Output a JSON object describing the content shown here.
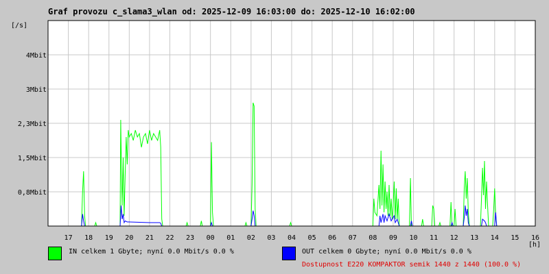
{
  "title": "Graf provozu c_slama3_wlan od: 2025-12-09 16:03:00 do: 2025-12-10 16:02:00",
  "colors": {
    "in": "#00ff00",
    "out": "#0000ff",
    "availability": "#e00000",
    "grid": "#c8c8c8"
  },
  "legend": {
    "in_text": "IN celkem 1 Gbyte; nyní   0.0 Mbit/s 0.0 %",
    "out_text": "OUT celkem 0 Gbyte; nyní   0.0 Mbit/s 0.0 %",
    "availability_text": "Dostupnost E220 KOMPAKTOR semik 1440 z 1440 (100.0 %)"
  },
  "chart_data": {
    "type": "line",
    "ylabel": "[/s]",
    "xlabel": "[h]",
    "xlim": [
      16.0,
      40.0
    ],
    "ylim": [
      0,
      6.0
    ],
    "y_ticks": [
      {
        "value": 1,
        "label": "0,8Mbit"
      },
      {
        "value": 2,
        "label": "1,5Mbit"
      },
      {
        "value": 3,
        "label": "2,3Mbit"
      },
      {
        "value": 4,
        "label": "3Mbit"
      },
      {
        "value": 5,
        "label": "4Mbit"
      },
      {
        "value": 6,
        "label": "[/s]"
      }
    ],
    "x_ticks": [
      {
        "value": 17,
        "label": "17"
      },
      {
        "value": 18,
        "label": "18"
      },
      {
        "value": 19,
        "label": "19"
      },
      {
        "value": 20,
        "label": "20"
      },
      {
        "value": 21,
        "label": "21"
      },
      {
        "value": 22,
        "label": "22"
      },
      {
        "value": 23,
        "label": "23"
      },
      {
        "value": 24,
        "label": "00"
      },
      {
        "value": 25,
        "label": "01"
      },
      {
        "value": 26,
        "label": "02"
      },
      {
        "value": 27,
        "label": "03"
      },
      {
        "value": 28,
        "label": "04"
      },
      {
        "value": 29,
        "label": "05"
      },
      {
        "value": 30,
        "label": "06"
      },
      {
        "value": 31,
        "label": "07"
      },
      {
        "value": 32,
        "label": "08"
      },
      {
        "value": 33,
        "label": "09"
      },
      {
        "value": 34,
        "label": "10"
      },
      {
        "value": 35,
        "label": "11"
      },
      {
        "value": 36,
        "label": "12"
      },
      {
        "value": 37,
        "label": "13"
      },
      {
        "value": 38,
        "label": "14"
      },
      {
        "value": 39,
        "label": "15"
      },
      {
        "value": 40,
        "label": "16"
      }
    ],
    "series": [
      {
        "name": "IN",
        "color": "#00ff00",
        "points": [
          [
            16.0,
            0
          ],
          [
            17.65,
            0
          ],
          [
            17.7,
            1.0
          ],
          [
            17.75,
            1.6
          ],
          [
            17.8,
            0.3
          ],
          [
            17.85,
            0
          ],
          [
            18.3,
            0
          ],
          [
            18.35,
            0.1
          ],
          [
            18.4,
            0
          ],
          [
            19.55,
            0
          ],
          [
            19.58,
            3.1
          ],
          [
            19.62,
            1.5
          ],
          [
            19.65,
            0.6
          ],
          [
            19.7,
            2.0
          ],
          [
            19.75,
            0.3
          ],
          [
            19.8,
            1.5
          ],
          [
            19.85,
            2.6
          ],
          [
            19.9,
            1.8
          ],
          [
            19.95,
            2.8
          ],
          [
            20.0,
            2.6
          ],
          [
            20.1,
            2.7
          ],
          [
            20.2,
            2.5
          ],
          [
            20.3,
            2.8
          ],
          [
            20.4,
            2.6
          ],
          [
            20.5,
            2.7
          ],
          [
            20.6,
            2.3
          ],
          [
            20.7,
            2.6
          ],
          [
            20.8,
            2.7
          ],
          [
            20.9,
            2.4
          ],
          [
            21.0,
            2.8
          ],
          [
            21.1,
            2.5
          ],
          [
            21.2,
            2.7
          ],
          [
            21.3,
            2.6
          ],
          [
            21.4,
            2.5
          ],
          [
            21.5,
            2.8
          ],
          [
            21.55,
            2.3
          ],
          [
            21.6,
            0.2
          ],
          [
            21.65,
            0
          ],
          [
            22.8,
            0
          ],
          [
            22.85,
            0.1
          ],
          [
            22.9,
            0
          ],
          [
            23.5,
            0
          ],
          [
            23.55,
            0.15
          ],
          [
            23.6,
            0
          ],
          [
            24.0,
            0
          ],
          [
            24.05,
            2.45
          ],
          [
            24.1,
            0.4
          ],
          [
            24.15,
            0
          ],
          [
            25.7,
            0
          ],
          [
            25.75,
            0.1
          ],
          [
            25.8,
            0
          ],
          [
            26.0,
            0
          ],
          [
            26.05,
            1.2
          ],
          [
            26.1,
            3.6
          ],
          [
            26.15,
            3.5
          ],
          [
            26.2,
            0.5
          ],
          [
            26.25,
            0
          ],
          [
            27.9,
            0
          ],
          [
            27.95,
            0.1
          ],
          [
            28.0,
            0
          ],
          [
            32.0,
            0
          ],
          [
            32.05,
            0.8
          ],
          [
            32.1,
            0.4
          ],
          [
            32.2,
            0.3
          ],
          [
            32.3,
            1.2
          ],
          [
            32.35,
            0.5
          ],
          [
            32.4,
            2.2
          ],
          [
            32.45,
            0.6
          ],
          [
            32.5,
            1.8
          ],
          [
            32.55,
            0.4
          ],
          [
            32.6,
            1.3
          ],
          [
            32.65,
            0.5
          ],
          [
            32.7,
            1.0
          ],
          [
            32.75,
            0.3
          ],
          [
            32.8,
            1.2
          ],
          [
            32.85,
            0.3
          ],
          [
            32.9,
            0.8
          ],
          [
            32.95,
            0.2
          ],
          [
            33.0,
            0.6
          ],
          [
            33.05,
            1.3
          ],
          [
            33.1,
            0.2
          ],
          [
            33.15,
            1.1
          ],
          [
            33.2,
            0.2
          ],
          [
            33.25,
            0.8
          ],
          [
            33.3,
            0
          ],
          [
            33.8,
            0
          ],
          [
            33.85,
            1.4
          ],
          [
            33.9,
            0
          ],
          [
            34.4,
            0
          ],
          [
            34.45,
            0.2
          ],
          [
            34.5,
            0
          ],
          [
            34.9,
            0
          ],
          [
            34.95,
            0.6
          ],
          [
            35.0,
            0.5
          ],
          [
            35.05,
            0
          ],
          [
            35.25,
            0
          ],
          [
            35.3,
            0.1
          ],
          [
            35.35,
            0
          ],
          [
            35.8,
            0
          ],
          [
            35.85,
            0.7
          ],
          [
            35.9,
            0
          ],
          [
            36.0,
            0
          ],
          [
            36.05,
            0.5
          ],
          [
            36.1,
            0
          ],
          [
            36.45,
            0
          ],
          [
            36.5,
            1.1
          ],
          [
            36.55,
            1.6
          ],
          [
            36.6,
            0.8
          ],
          [
            36.65,
            1.4
          ],
          [
            36.7,
            0.4
          ],
          [
            36.75,
            0
          ],
          [
            37.3,
            0
          ],
          [
            37.35,
            0.8
          ],
          [
            37.4,
            1.7
          ],
          [
            37.45,
            0.9
          ],
          [
            37.5,
            1.9
          ],
          [
            37.55,
            0.5
          ],
          [
            37.6,
            1.3
          ],
          [
            37.65,
            0.6
          ],
          [
            37.7,
            0
          ],
          [
            37.9,
            0
          ],
          [
            37.95,
            0.5
          ],
          [
            38.0,
            1.1
          ],
          [
            38.05,
            0.3
          ],
          [
            38.1,
            0
          ],
          [
            40.0,
            0
          ]
        ]
      },
      {
        "name": "OUT",
        "color": "#0000ff",
        "points": [
          [
            16.0,
            0
          ],
          [
            17.65,
            0
          ],
          [
            17.7,
            0.35
          ],
          [
            17.75,
            0.15
          ],
          [
            17.8,
            0
          ],
          [
            19.55,
            0
          ],
          [
            19.6,
            0.6
          ],
          [
            19.65,
            0.2
          ],
          [
            19.7,
            0.35
          ],
          [
            19.75,
            0.1
          ],
          [
            19.8,
            0.15
          ],
          [
            19.9,
            0.12
          ],
          [
            20.0,
            0.12
          ],
          [
            21.0,
            0.1
          ],
          [
            21.5,
            0.1
          ],
          [
            21.55,
            0.08
          ],
          [
            21.6,
            0
          ],
          [
            24.0,
            0
          ],
          [
            24.05,
            0.1
          ],
          [
            24.1,
            0
          ],
          [
            26.0,
            0
          ],
          [
            26.05,
            0.2
          ],
          [
            26.1,
            0.45
          ],
          [
            26.15,
            0.3
          ],
          [
            26.2,
            0
          ],
          [
            32.3,
            0
          ],
          [
            32.35,
            0.3
          ],
          [
            32.4,
            0.1
          ],
          [
            32.5,
            0.35
          ],
          [
            32.55,
            0.1
          ],
          [
            32.6,
            0.3
          ],
          [
            32.7,
            0.15
          ],
          [
            32.8,
            0.35
          ],
          [
            32.9,
            0.15
          ],
          [
            33.0,
            0.25
          ],
          [
            33.05,
            0.3
          ],
          [
            33.1,
            0.1
          ],
          [
            33.2,
            0.2
          ],
          [
            33.3,
            0
          ],
          [
            33.85,
            0
          ],
          [
            33.9,
            0.15
          ],
          [
            33.95,
            0
          ],
          [
            35.85,
            0
          ],
          [
            35.9,
            0.1
          ],
          [
            35.95,
            0
          ],
          [
            36.45,
            0
          ],
          [
            36.5,
            0.25
          ],
          [
            36.55,
            0.6
          ],
          [
            36.6,
            0.3
          ],
          [
            36.65,
            0.5
          ],
          [
            36.7,
            0.1
          ],
          [
            36.75,
            0
          ],
          [
            37.35,
            0
          ],
          [
            37.4,
            0.2
          ],
          [
            37.5,
            0.15
          ],
          [
            37.55,
            0.1
          ],
          [
            37.6,
            0
          ],
          [
            38.0,
            0
          ],
          [
            38.05,
            0.4
          ],
          [
            38.1,
            0
          ],
          [
            40.0,
            0
          ]
        ]
      }
    ]
  }
}
